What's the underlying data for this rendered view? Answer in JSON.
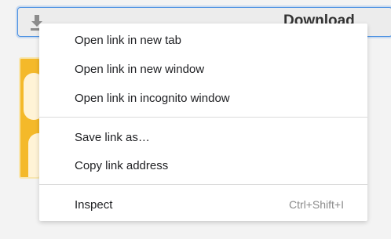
{
  "download_button": {
    "label": "Download",
    "icon": "download-icon"
  },
  "context_menu": {
    "items": [
      {
        "label": "Open link in new tab",
        "shortcut": ""
      },
      {
        "label": "Open link in new window",
        "shortcut": ""
      },
      {
        "label": "Open link in incognito window",
        "shortcut": ""
      },
      {
        "label": "Save link as…",
        "shortcut": ""
      },
      {
        "label": "Copy link address",
        "shortcut": ""
      },
      {
        "label": "Inspect",
        "shortcut": "Ctrl+Shift+I"
      }
    ]
  },
  "colors": {
    "accent": "#4a90e2",
    "thumbnail": "#f4b92a",
    "menu_bg": "#ffffff"
  }
}
